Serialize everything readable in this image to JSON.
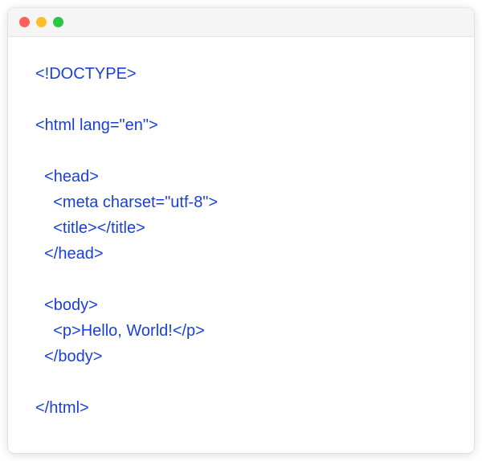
{
  "code": {
    "line1": "<!DOCTYPE>",
    "line2": "",
    "line3": "<html lang=\"en\">",
    "line4": "",
    "line5": "  <head>",
    "line6": "    <meta charset=\"utf-8\">",
    "line7": "    <title></title>",
    "line8": "  </head>",
    "line9": "",
    "line10": "  <body>",
    "line11": "    <p>Hello, World!</p>",
    "line12": "  </body>",
    "line13": "",
    "line14": "</html>"
  }
}
